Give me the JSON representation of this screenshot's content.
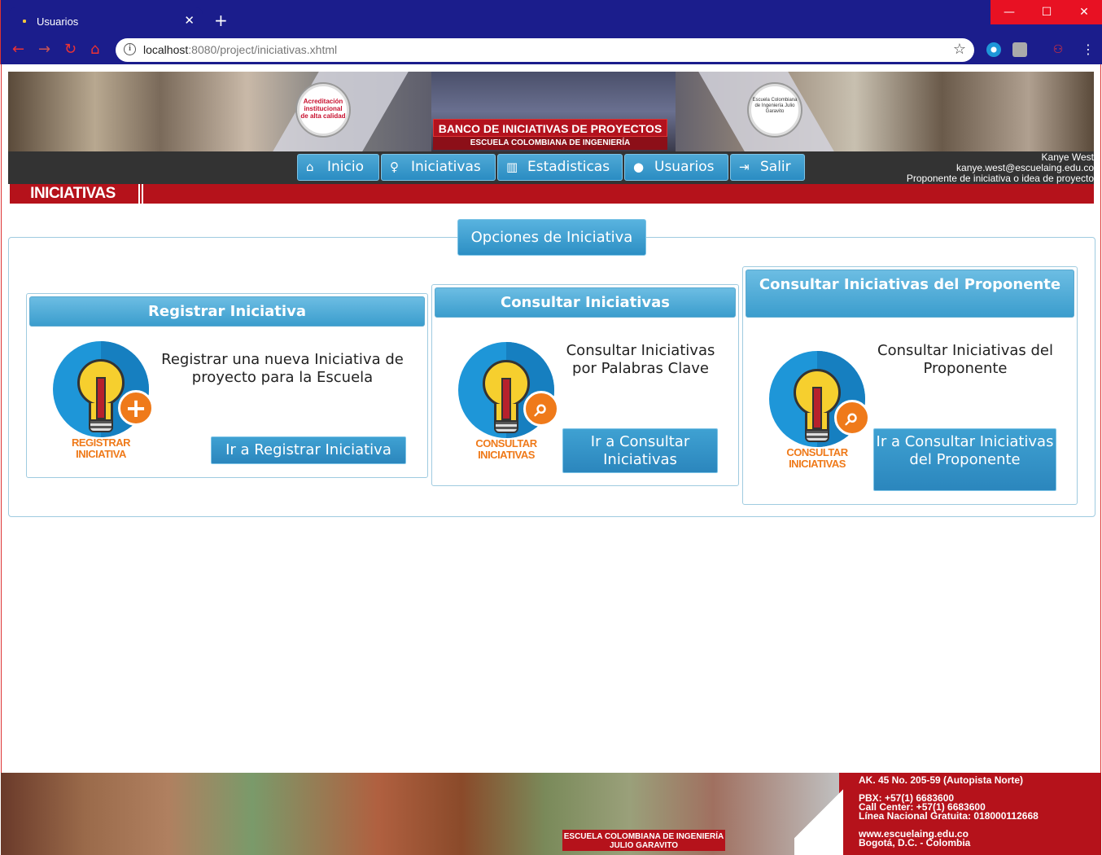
{
  "browser": {
    "tab_title": "Usuarios",
    "tab_close": "✕",
    "new_tab": "+",
    "url_host": "localhost",
    "url_rest": ":8080/project/iniciativas.xhtml",
    "window_minimize": "—",
    "window_maximize": "☐",
    "window_close": "✕"
  },
  "banner": {
    "seal_left": "Acreditación institucional de alta calidad",
    "seal_right": "Escuela Colombiana de Ingeniería Julio Garavito",
    "title": "BANCO DE INICIATIVAS DE PROYECTOS",
    "subtitle": "ESCUELA COLOMBIANA DE INGENIERÍA"
  },
  "menu": {
    "items": [
      {
        "label": "Inicio",
        "icon": "home-icon"
      },
      {
        "label": "Iniciativas",
        "icon": "lightbulb-icon"
      },
      {
        "label": "Estadisticas",
        "icon": "bar-chart-icon"
      },
      {
        "label": "Usuarios",
        "icon": "user-icon"
      },
      {
        "label": "Salir",
        "icon": "logout-icon"
      }
    ]
  },
  "user": {
    "name": "Kanye West",
    "email": "kanye.west@escuelaing.edu.co",
    "role": "Proponente de iniciativa o idea de proyecto"
  },
  "section": {
    "title": "INICIATIVAS"
  },
  "options": {
    "legend": "Opciones de Iniciativa",
    "panels": [
      {
        "header": "Registrar Iniciativa",
        "description": "Registrar una nueva Iniciativa de proyecto para la Escuela",
        "button": "Ir a Registrar Iniciativa",
        "icon_caption_1": "REGISTRAR",
        "icon_caption_2": "INICIATIVA",
        "badge": "+"
      },
      {
        "header": "Consultar Iniciativas",
        "description": "Consultar Iniciativas por Palabras Clave",
        "button": "Ir a Consultar Iniciativas",
        "icon_caption_1": "CONSULTAR",
        "icon_caption_2": "INICIATIVAS",
        "badge": "⌕"
      },
      {
        "header": "Consultar Iniciativas del Proponente",
        "description": "Consultar Iniciativas del Proponente",
        "button": "Ir a Consultar Iniciativas del Proponente",
        "icon_caption_1": "CONSULTAR",
        "icon_caption_2": "INICIATIVAS",
        "badge": "⌕"
      }
    ]
  },
  "footer": {
    "slab_line1": "ESCUELA COLOMBIANA DE INGENIERÍA",
    "slab_line2": "JULIO GARAVITO",
    "address": "AK. 45 No. 205-59 (Autopista Norte)",
    "pbx": "PBX: +57(1) 6683600",
    "call_center": "Call Center: +57(1) 6683600",
    "linea": "Línea Nacional Gratuita: 018000112668",
    "web": "www.escuelaing.edu.co",
    "city": "Bogotá, D.C. - Colombia"
  },
  "colors": {
    "brand_red": "#b5121b",
    "accent_blue": "#2a8cc2",
    "icon_orange": "#ef7a1a"
  }
}
